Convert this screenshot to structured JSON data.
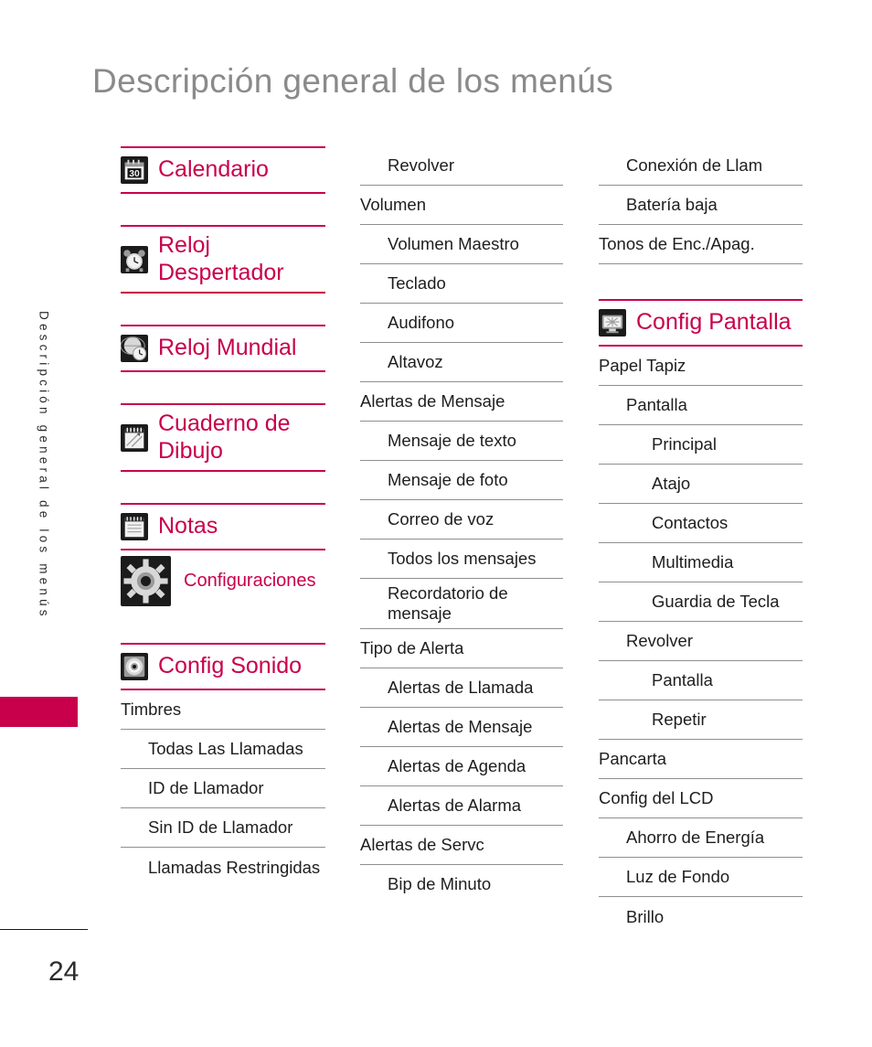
{
  "page": {
    "title": "Descripción general de los menús",
    "running_head": "Descripción general de los menús",
    "folio": "24",
    "accent_color": "#C8004B",
    "title_color": "#8A8A8A",
    "text_color": "#1E1E1E",
    "rule_color": "#8F8F8F"
  },
  "columns": [
    {
      "name": "column-1",
      "rows": [
        {
          "text": "Calendario",
          "level": 0,
          "type": "header",
          "icon": "calendar-icon",
          "rule_above": "pink",
          "rule_below": "pink"
        },
        {
          "text": "",
          "level": 0,
          "type": "spacer",
          "icon": null,
          "rule_above": "none",
          "rule_below": "none"
        },
        {
          "text": "Reloj Despertador",
          "level": 0,
          "type": "header",
          "icon": "alarm-clock-icon",
          "rule_above": "pink",
          "rule_below": "pink"
        },
        {
          "text": "",
          "level": 0,
          "type": "spacer",
          "icon": null,
          "rule_above": "none",
          "rule_below": "none"
        },
        {
          "text": "Reloj Mundial",
          "level": 0,
          "type": "header",
          "icon": "world-clock-icon",
          "rule_above": "pink",
          "rule_below": "pink"
        },
        {
          "text": "",
          "level": 0,
          "type": "spacer",
          "icon": null,
          "rule_above": "none",
          "rule_below": "none"
        },
        {
          "text": "Cuaderno de Dibujo",
          "level": 0,
          "type": "header",
          "icon": "sketchpad-icon",
          "rule_above": "pink",
          "rule_below": "pink"
        },
        {
          "text": "",
          "level": 0,
          "type": "spacer",
          "icon": null,
          "rule_above": "none",
          "rule_below": "none"
        },
        {
          "text": "Notas",
          "level": 0,
          "type": "header",
          "icon": "notepad-icon",
          "rule_above": "pink",
          "rule_below": "pink"
        },
        {
          "text": "Configuraciones",
          "level": 0,
          "type": "header-small",
          "icon": "gear-icon",
          "rule_above": "none",
          "rule_below": "none"
        },
        {
          "text": "",
          "level": 0,
          "type": "spacer",
          "icon": null,
          "rule_above": "none",
          "rule_below": "none"
        },
        {
          "text": "Config Sonido",
          "level": 0,
          "type": "header",
          "icon": "speaker-icon",
          "rule_above": "pink",
          "rule_below": "pink"
        },
        {
          "text": "Timbres",
          "level": 0,
          "type": "item",
          "icon": null,
          "rule_above": "none",
          "rule_below": "thin"
        },
        {
          "text": "Todas Las Llamadas",
          "level": 1,
          "type": "item",
          "icon": null,
          "rule_above": "none",
          "rule_below": "thin"
        },
        {
          "text": "ID de Llamador",
          "level": 1,
          "type": "item",
          "icon": null,
          "rule_above": "none",
          "rule_below": "thin"
        },
        {
          "text": "Sin ID de Llamador",
          "level": 1,
          "type": "item",
          "icon": null,
          "rule_above": "none",
          "rule_below": "thin"
        },
        {
          "text": "Llamadas Restringidas",
          "level": 1,
          "type": "item",
          "icon": null,
          "rule_above": "none",
          "rule_below": "none"
        }
      ]
    },
    {
      "name": "column-2",
      "rows": [
        {
          "text": "Revolver",
          "level": 1,
          "type": "item",
          "icon": null,
          "rule_above": "none",
          "rule_below": "thin"
        },
        {
          "text": "Volumen",
          "level": 0,
          "type": "item",
          "icon": null,
          "rule_above": "none",
          "rule_below": "thin"
        },
        {
          "text": "Volumen Maestro",
          "level": 1,
          "type": "item",
          "icon": null,
          "rule_above": "none",
          "rule_below": "thin"
        },
        {
          "text": "Teclado",
          "level": 1,
          "type": "item",
          "icon": null,
          "rule_above": "none",
          "rule_below": "thin"
        },
        {
          "text": "Audifono",
          "level": 1,
          "type": "item",
          "icon": null,
          "rule_above": "none",
          "rule_below": "thin"
        },
        {
          "text": "Altavoz",
          "level": 1,
          "type": "item",
          "icon": null,
          "rule_above": "none",
          "rule_below": "thin"
        },
        {
          "text": "Alertas de Mensaje",
          "level": 0,
          "type": "item",
          "icon": null,
          "rule_above": "none",
          "rule_below": "thin"
        },
        {
          "text": "Mensaje de texto",
          "level": 1,
          "type": "item",
          "icon": null,
          "rule_above": "none",
          "rule_below": "thin"
        },
        {
          "text": "Mensaje de foto",
          "level": 1,
          "type": "item",
          "icon": null,
          "rule_above": "none",
          "rule_below": "thin"
        },
        {
          "text": "Correo de voz",
          "level": 1,
          "type": "item",
          "icon": null,
          "rule_above": "none",
          "rule_below": "thin"
        },
        {
          "text": "Todos los mensajes",
          "level": 1,
          "type": "item",
          "icon": null,
          "rule_above": "none",
          "rule_below": "thin"
        },
        {
          "text": "Recordatorio de mensaje",
          "level": 1,
          "type": "item",
          "icon": null,
          "rule_above": "none",
          "rule_below": "thin"
        },
        {
          "text": "Tipo de Alerta",
          "level": 0,
          "type": "item",
          "icon": null,
          "rule_above": "none",
          "rule_below": "thin"
        },
        {
          "text": "Alertas de Llamada",
          "level": 1,
          "type": "item",
          "icon": null,
          "rule_above": "none",
          "rule_below": "thin"
        },
        {
          "text": "Alertas de Mensaje",
          "level": 1,
          "type": "item",
          "icon": null,
          "rule_above": "none",
          "rule_below": "thin"
        },
        {
          "text": "Alertas de Agenda",
          "level": 1,
          "type": "item",
          "icon": null,
          "rule_above": "none",
          "rule_below": "thin"
        },
        {
          "text": "Alertas de Alarma",
          "level": 1,
          "type": "item",
          "icon": null,
          "rule_above": "none",
          "rule_below": "thin"
        },
        {
          "text": "Alertas de Servc",
          "level": 0,
          "type": "item",
          "icon": null,
          "rule_above": "none",
          "rule_below": "thin"
        },
        {
          "text": "Bip de Minuto",
          "level": 1,
          "type": "item",
          "icon": null,
          "rule_above": "none",
          "rule_below": "none"
        }
      ]
    },
    {
      "name": "column-3",
      "rows": [
        {
          "text": "Conexión de Llam",
          "level": 1,
          "type": "item",
          "icon": null,
          "rule_above": "none",
          "rule_below": "thin"
        },
        {
          "text": "Batería baja",
          "level": 1,
          "type": "item",
          "icon": null,
          "rule_above": "none",
          "rule_below": "thin"
        },
        {
          "text": "Tonos de Enc./Apag.",
          "level": 0,
          "type": "item",
          "icon": null,
          "rule_above": "none",
          "rule_below": "thin"
        },
        {
          "text": "",
          "level": 0,
          "type": "spacer",
          "icon": null,
          "rule_above": "none",
          "rule_below": "none"
        },
        {
          "text": "Config Pantalla",
          "level": 0,
          "type": "header",
          "icon": "display-icon",
          "rule_above": "pink",
          "rule_below": "pink"
        },
        {
          "text": "Papel Tapiz",
          "level": 0,
          "type": "item",
          "icon": null,
          "rule_above": "none",
          "rule_below": "thin"
        },
        {
          "text": "Pantalla",
          "level": 1,
          "type": "item",
          "icon": null,
          "rule_above": "none",
          "rule_below": "thin"
        },
        {
          "text": "Principal",
          "level": 2,
          "type": "item",
          "icon": null,
          "rule_above": "none",
          "rule_below": "thin"
        },
        {
          "text": "Atajo",
          "level": 2,
          "type": "item",
          "icon": null,
          "rule_above": "none",
          "rule_below": "thin"
        },
        {
          "text": "Contactos",
          "level": 2,
          "type": "item",
          "icon": null,
          "rule_above": "none",
          "rule_below": "thin"
        },
        {
          "text": "Multimedia",
          "level": 2,
          "type": "item",
          "icon": null,
          "rule_above": "none",
          "rule_below": "thin"
        },
        {
          "text": "Guardia de Tecla",
          "level": 2,
          "type": "item",
          "icon": null,
          "rule_above": "none",
          "rule_below": "thin"
        },
        {
          "text": "Revolver",
          "level": 1,
          "type": "item",
          "icon": null,
          "rule_above": "none",
          "rule_below": "thin"
        },
        {
          "text": "Pantalla",
          "level": 2,
          "type": "item",
          "icon": null,
          "rule_above": "none",
          "rule_below": "thin"
        },
        {
          "text": "Repetir",
          "level": 2,
          "type": "item",
          "icon": null,
          "rule_above": "none",
          "rule_below": "thin"
        },
        {
          "text": "Pancarta",
          "level": 0,
          "type": "item",
          "icon": null,
          "rule_above": "none",
          "rule_below": "thin"
        },
        {
          "text": "Config del LCD",
          "level": 0,
          "type": "item",
          "icon": null,
          "rule_above": "none",
          "rule_below": "thin"
        },
        {
          "text": "Ahorro de Energía",
          "level": 1,
          "type": "item",
          "icon": null,
          "rule_above": "none",
          "rule_below": "thin"
        },
        {
          "text": "Luz de Fondo",
          "level": 1,
          "type": "item",
          "icon": null,
          "rule_above": "none",
          "rule_below": "thin"
        },
        {
          "text": "Brillo",
          "level": 1,
          "type": "item",
          "icon": null,
          "rule_above": "none",
          "rule_below": "none"
        }
      ]
    }
  ]
}
